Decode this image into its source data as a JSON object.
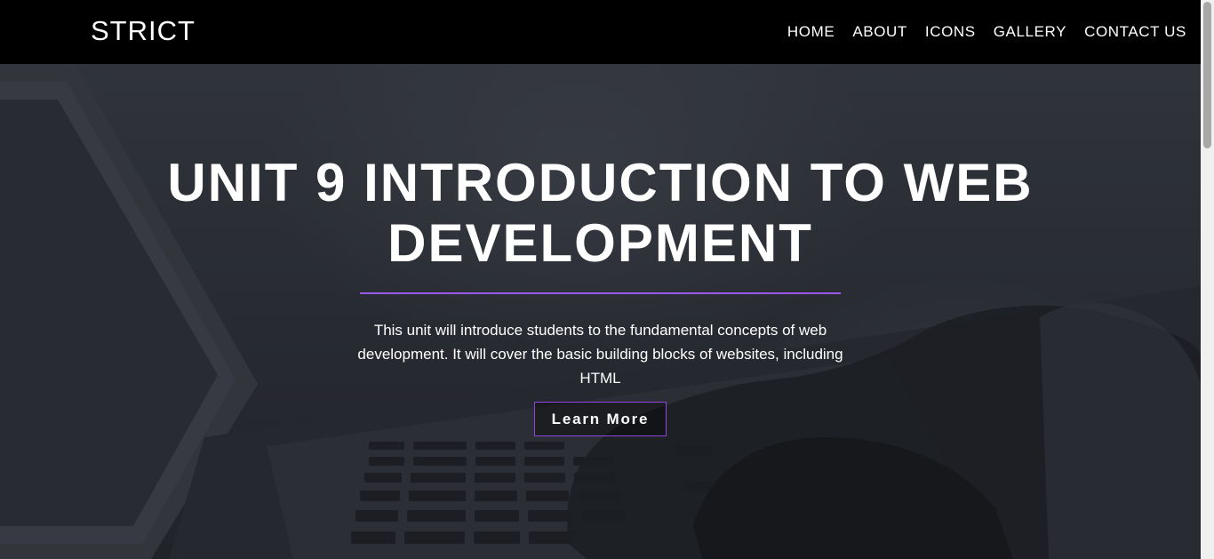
{
  "navbar": {
    "brand": "STRICT",
    "links": [
      {
        "label": "HOME"
      },
      {
        "label": "ABOUT"
      },
      {
        "label": "ICONS"
      },
      {
        "label": "GALLERY"
      },
      {
        "label": "CONTACT US"
      }
    ]
  },
  "hero": {
    "title": "UNIT 9 INTRODUCTION TO WEB DEVELOPMENT",
    "description": "This unit will introduce students to the fundamental concepts of web development. It will cover the basic building blocks of websites, including HTML",
    "button_label": "Learn More",
    "background_image": "laptop-typing-photo"
  },
  "colors": {
    "navbar_bg": "#000000",
    "accent": "#9b59e8",
    "text": "#ffffff"
  }
}
